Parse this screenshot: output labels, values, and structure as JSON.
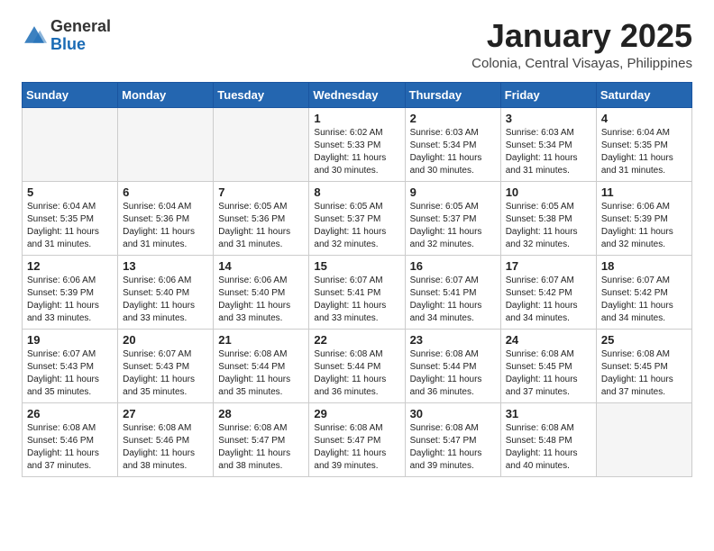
{
  "header": {
    "logo_general": "General",
    "logo_blue": "Blue",
    "month_title": "January 2025",
    "location": "Colonia, Central Visayas, Philippines"
  },
  "weekdays": [
    "Sunday",
    "Monday",
    "Tuesday",
    "Wednesday",
    "Thursday",
    "Friday",
    "Saturday"
  ],
  "weeks": [
    [
      {
        "day": "",
        "empty": true
      },
      {
        "day": "",
        "empty": true
      },
      {
        "day": "",
        "empty": true
      },
      {
        "day": "1",
        "sunrise": "6:02 AM",
        "sunset": "5:33 PM",
        "daylight": "11 hours and 30 minutes."
      },
      {
        "day": "2",
        "sunrise": "6:03 AM",
        "sunset": "5:34 PM",
        "daylight": "11 hours and 30 minutes."
      },
      {
        "day": "3",
        "sunrise": "6:03 AM",
        "sunset": "5:34 PM",
        "daylight": "11 hours and 31 minutes."
      },
      {
        "day": "4",
        "sunrise": "6:04 AM",
        "sunset": "5:35 PM",
        "daylight": "11 hours and 31 minutes."
      }
    ],
    [
      {
        "day": "5",
        "sunrise": "6:04 AM",
        "sunset": "5:35 PM",
        "daylight": "11 hours and 31 minutes."
      },
      {
        "day": "6",
        "sunrise": "6:04 AM",
        "sunset": "5:36 PM",
        "daylight": "11 hours and 31 minutes."
      },
      {
        "day": "7",
        "sunrise": "6:05 AM",
        "sunset": "5:36 PM",
        "daylight": "11 hours and 31 minutes."
      },
      {
        "day": "8",
        "sunrise": "6:05 AM",
        "sunset": "5:37 PM",
        "daylight": "11 hours and 32 minutes."
      },
      {
        "day": "9",
        "sunrise": "6:05 AM",
        "sunset": "5:37 PM",
        "daylight": "11 hours and 32 minutes."
      },
      {
        "day": "10",
        "sunrise": "6:05 AM",
        "sunset": "5:38 PM",
        "daylight": "11 hours and 32 minutes."
      },
      {
        "day": "11",
        "sunrise": "6:06 AM",
        "sunset": "5:39 PM",
        "daylight": "11 hours and 32 minutes."
      }
    ],
    [
      {
        "day": "12",
        "sunrise": "6:06 AM",
        "sunset": "5:39 PM",
        "daylight": "11 hours and 33 minutes."
      },
      {
        "day": "13",
        "sunrise": "6:06 AM",
        "sunset": "5:40 PM",
        "daylight": "11 hours and 33 minutes."
      },
      {
        "day": "14",
        "sunrise": "6:06 AM",
        "sunset": "5:40 PM",
        "daylight": "11 hours and 33 minutes."
      },
      {
        "day": "15",
        "sunrise": "6:07 AM",
        "sunset": "5:41 PM",
        "daylight": "11 hours and 33 minutes."
      },
      {
        "day": "16",
        "sunrise": "6:07 AM",
        "sunset": "5:41 PM",
        "daylight": "11 hours and 34 minutes."
      },
      {
        "day": "17",
        "sunrise": "6:07 AM",
        "sunset": "5:42 PM",
        "daylight": "11 hours and 34 minutes."
      },
      {
        "day": "18",
        "sunrise": "6:07 AM",
        "sunset": "5:42 PM",
        "daylight": "11 hours and 34 minutes."
      }
    ],
    [
      {
        "day": "19",
        "sunrise": "6:07 AM",
        "sunset": "5:43 PM",
        "daylight": "11 hours and 35 minutes."
      },
      {
        "day": "20",
        "sunrise": "6:07 AM",
        "sunset": "5:43 PM",
        "daylight": "11 hours and 35 minutes."
      },
      {
        "day": "21",
        "sunrise": "6:08 AM",
        "sunset": "5:44 PM",
        "daylight": "11 hours and 35 minutes."
      },
      {
        "day": "22",
        "sunrise": "6:08 AM",
        "sunset": "5:44 PM",
        "daylight": "11 hours and 36 minutes."
      },
      {
        "day": "23",
        "sunrise": "6:08 AM",
        "sunset": "5:44 PM",
        "daylight": "11 hours and 36 minutes."
      },
      {
        "day": "24",
        "sunrise": "6:08 AM",
        "sunset": "5:45 PM",
        "daylight": "11 hours and 37 minutes."
      },
      {
        "day": "25",
        "sunrise": "6:08 AM",
        "sunset": "5:45 PM",
        "daylight": "11 hours and 37 minutes."
      }
    ],
    [
      {
        "day": "26",
        "sunrise": "6:08 AM",
        "sunset": "5:46 PM",
        "daylight": "11 hours and 37 minutes."
      },
      {
        "day": "27",
        "sunrise": "6:08 AM",
        "sunset": "5:46 PM",
        "daylight": "11 hours and 38 minutes."
      },
      {
        "day": "28",
        "sunrise": "6:08 AM",
        "sunset": "5:47 PM",
        "daylight": "11 hours and 38 minutes."
      },
      {
        "day": "29",
        "sunrise": "6:08 AM",
        "sunset": "5:47 PM",
        "daylight": "11 hours and 39 minutes."
      },
      {
        "day": "30",
        "sunrise": "6:08 AM",
        "sunset": "5:47 PM",
        "daylight": "11 hours and 39 minutes."
      },
      {
        "day": "31",
        "sunrise": "6:08 AM",
        "sunset": "5:48 PM",
        "daylight": "11 hours and 40 minutes."
      },
      {
        "day": "",
        "empty": true
      }
    ]
  ]
}
